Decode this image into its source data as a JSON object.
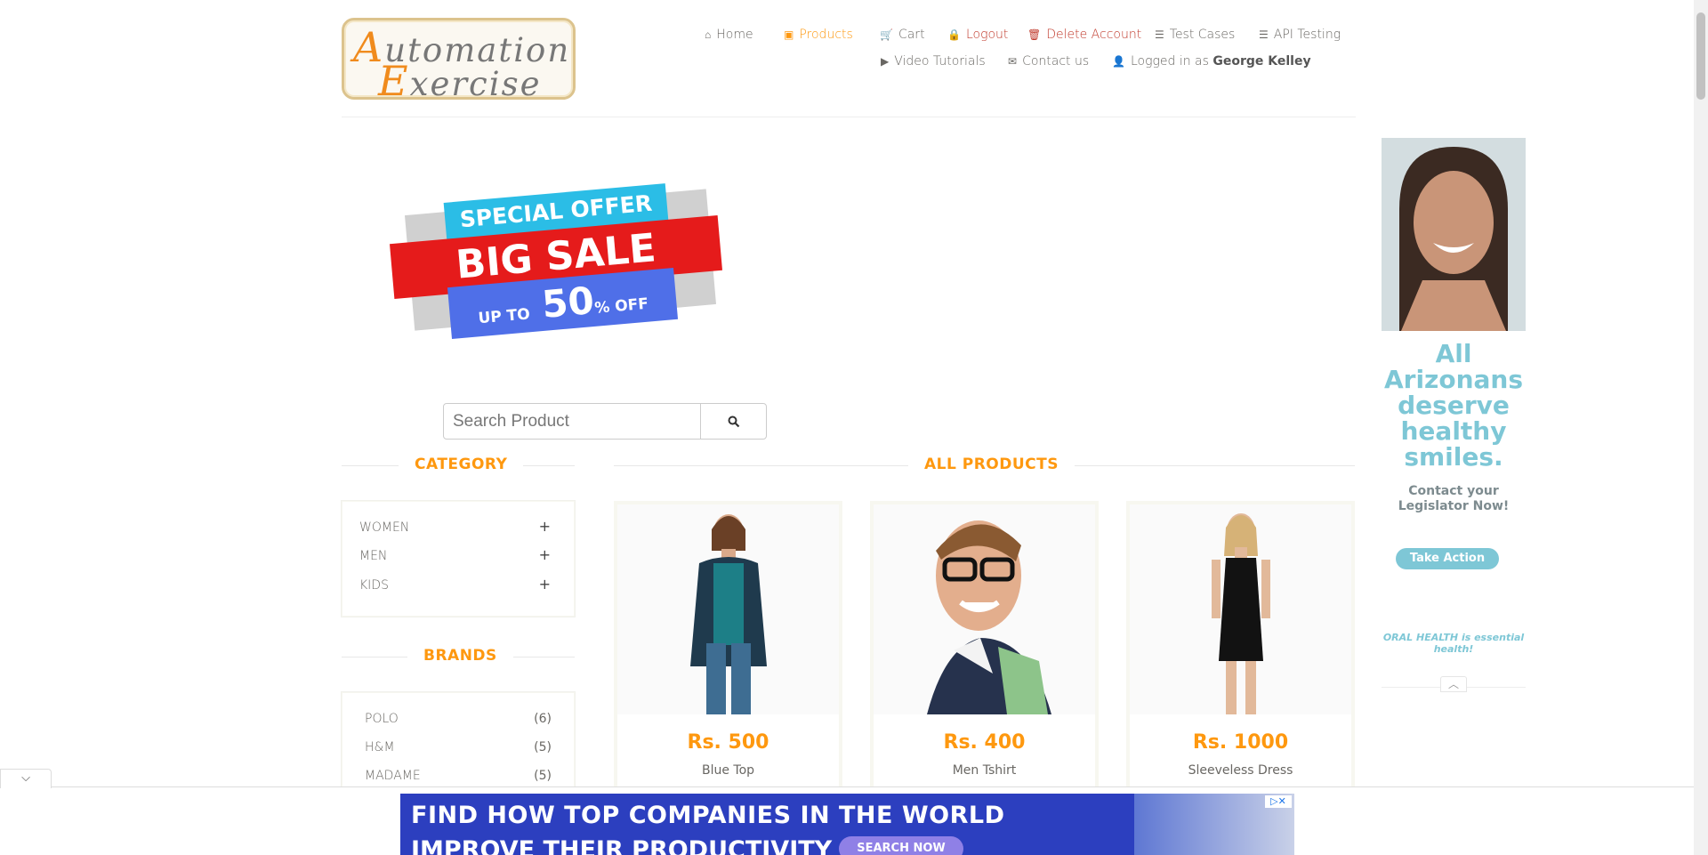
{
  "logo": {
    "line1_cap": "A",
    "line1_rest": "utomation",
    "line2_cap": "E",
    "line2_rest": "xercise"
  },
  "nav": {
    "home": "Home",
    "products": "Products",
    "cart": "Cart",
    "logout": "Logout",
    "delete_account": "Delete Account",
    "test_cases": "Test Cases",
    "api_testing": "API Testing",
    "video_tutorials": "Video Tutorials",
    "contact_us": "Contact us",
    "logged_in_prefix": "Logged in as",
    "logged_in_user": "George Kelley"
  },
  "banner": {
    "special_offer": "SPECIAL OFFER",
    "big_sale": "BIG SALE",
    "up_to": "UP TO",
    "percent": "50",
    "off": "% OFF"
  },
  "search": {
    "placeholder": "Search Product"
  },
  "category": {
    "title": "CATEGORY",
    "items": [
      {
        "label": "WOMEN"
      },
      {
        "label": "MEN"
      },
      {
        "label": "KIDS"
      }
    ]
  },
  "brands": {
    "title": "BRANDS",
    "items": [
      {
        "label": "POLO",
        "count": "(6)"
      },
      {
        "label": "H&M",
        "count": "(5)"
      },
      {
        "label": "MADAME",
        "count": "(5)"
      }
    ]
  },
  "products": {
    "title": "ALL PRODUCTS",
    "items": [
      {
        "price": "Rs. 500",
        "name": "Blue Top"
      },
      {
        "price": "Rs. 400",
        "name": "Men Tshirt"
      },
      {
        "price": "Rs. 1000",
        "name": "Sleeveless Dress"
      }
    ]
  },
  "ad_right": {
    "headline": "All Arizonans deserve healthy smiles.",
    "subline": "Contact your Legislator Now!",
    "cta": "Take Action",
    "footer": "ORAL HEALTH is essential health!"
  },
  "ad_bottom": {
    "line1": "FIND HOW TOP COMPANIES IN THE WORLD",
    "line2": "IMPROVE THEIR PRODUCTIVITY",
    "cta": "SEARCH NOW"
  },
  "colors": {
    "accent": "#fe980f",
    "danger": "#c0392b",
    "text": "#696763"
  }
}
